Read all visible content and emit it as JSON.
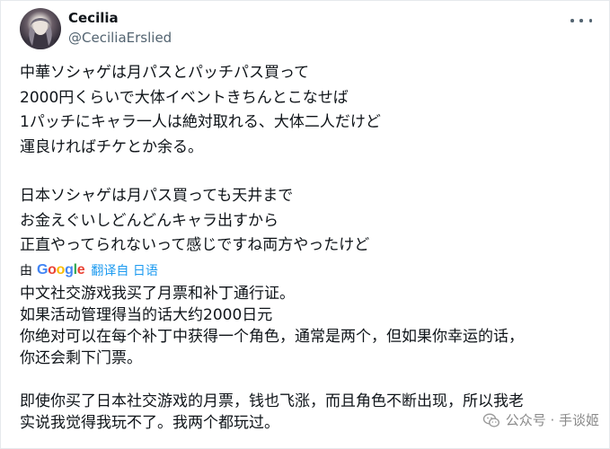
{
  "user": {
    "name": "Cecilia",
    "handle": "@CeciliaErslied"
  },
  "tweet": {
    "original_lines": [
      "中華ソシャゲは月パスとパッチパス買って",
      "2000円くらいで大体イベントきちんとこなせば",
      "1パッチにキャラ一人は絶対取れる、大体二人だけど",
      "運良ければチケとか余る。",
      "日本ソシャゲは月パス買っても天井まで",
      "お金えぐいしどんどんキャラ出すから",
      "正直やってられないって感じですね両方やったけど"
    ]
  },
  "translation": {
    "by_label": "由",
    "google_letters": [
      "G",
      "o",
      "o",
      "g",
      "l",
      "e"
    ],
    "link_text": "翻译自 日语",
    "lines": [
      "中文社交游戏我买了月票和补丁通行证。",
      "如果活动管理得当的话大约2000日元",
      "你绝对可以在每个补丁中获得一个角色，通常是两个，但如果你幸运的话，",
      "你还会剩下门票。",
      "即使你买了日本社交游戏的月票，钱也飞涨，而且角色不断出现，所以我老",
      "实说我觉得我玩不了。我两个都玩过。"
    ]
  },
  "watermark": {
    "text": "公众号 · 手谈姬"
  },
  "icons": {
    "more": "more-horizontal-icon",
    "watermark": "wechat-icon"
  },
  "colors": {
    "text": "#0f1419",
    "secondary": "#536471",
    "link": "#1d9bf0"
  }
}
